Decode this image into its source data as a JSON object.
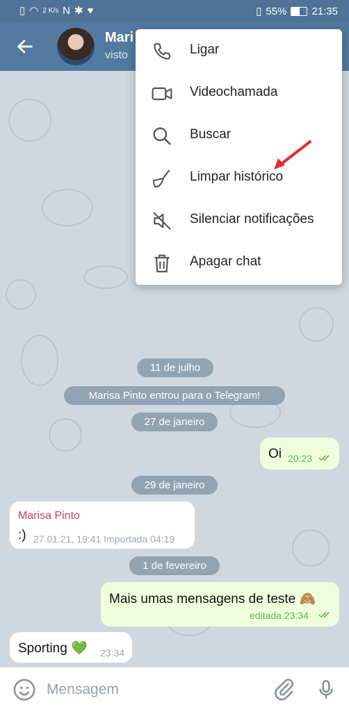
{
  "status_bar": {
    "kbps": "2 K/s",
    "battery": "55%",
    "time": "21:35"
  },
  "header": {
    "title": "Mari",
    "subtitle": "visto"
  },
  "menu": {
    "items": [
      {
        "label": "Ligar",
        "icon": "phone-icon"
      },
      {
        "label": "Videochamada",
        "icon": "video-icon"
      },
      {
        "label": "Buscar",
        "icon": "search-icon"
      },
      {
        "label": "Limpar histórico",
        "icon": "broom-icon"
      },
      {
        "label": "Silenciar notificações",
        "icon": "mute-icon"
      },
      {
        "label": "Apagar chat",
        "icon": "trash-icon"
      }
    ]
  },
  "chat": {
    "date_1": "11 de julho",
    "service_joined": "Marisa Pinto entrou para o Telegram!",
    "date_2": "27 de janeiro",
    "msg_oi": {
      "text": "Oi",
      "time": "20:23"
    },
    "date_3": "29 de janeiro",
    "msg_import": {
      "sender": "Marisa Pinto",
      "text": ":)",
      "meta": "27.01.21, 19:41 Importada 04:19"
    },
    "date_4": "1 de fevereiro",
    "msg_test": {
      "text": "Mais umas mensagens de teste 🙈",
      "meta": "editada 23:34"
    },
    "msg_sporting": {
      "text": "Sporting 💚",
      "time": "23:34"
    }
  },
  "input": {
    "placeholder": "Mensagem"
  },
  "colors": {
    "header": "#527aa0",
    "sender": "#c5454a",
    "outgoing": "#effedd",
    "check": "#5fb54e",
    "arrow": "#e52b2b"
  }
}
